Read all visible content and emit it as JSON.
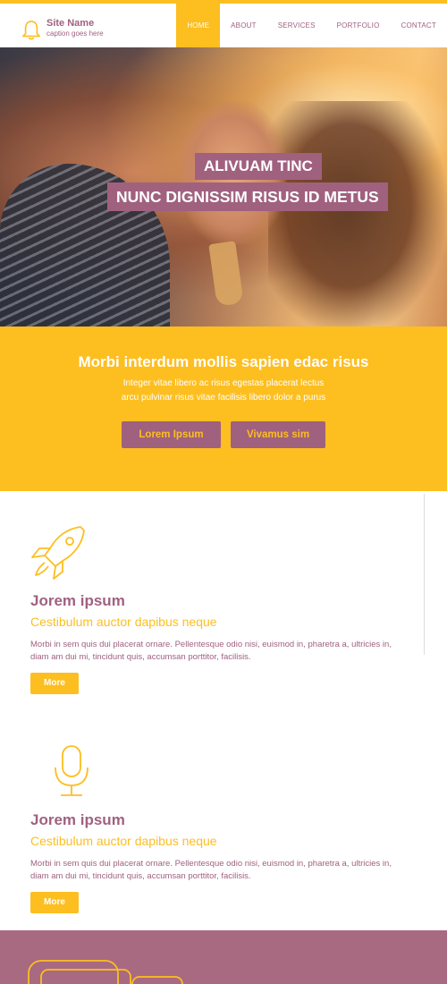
{
  "header": {
    "site_name": "Site Name",
    "caption": "caption goes here",
    "nav": [
      {
        "label": "HOME",
        "active": true
      },
      {
        "label": "ABOUT",
        "active": false
      },
      {
        "label": "SERVICES",
        "active": false
      },
      {
        "label": "PORTFOLIO",
        "active": false
      },
      {
        "label": "CONTACT",
        "active": false
      }
    ]
  },
  "hero": {
    "line1": "ALIVUAM TINC",
    "line2": "NUNC DIGNISSIM RISUS ID METUS"
  },
  "cta": {
    "title": "Morbi interdum mollis sapien edac risus",
    "text": "Integer vitae libero ac risus egestas placerat lectus arcu pulvinar risus vitae facilisis libero dolor a purus",
    "button1": "Lorem Ipsum",
    "button2": "Vivamus sim"
  },
  "features": [
    {
      "icon": "rocket-icon",
      "title": "Jorem ipsum",
      "subtitle": "Cestibulum auctor dapibus neque",
      "text": "Morbi in sem quis dui placerat ornare. Pellentesque odio nisi, euismod in, pharetra a, ultricies in, diam am dui mi, tincidunt quis, accumsan porttitor, facilisis.",
      "button": "More"
    },
    {
      "icon": "microphone-icon",
      "title": "Jorem ipsum",
      "subtitle": "Cestibulum auctor dapibus neque",
      "text": "Morbi in sem quis dui placerat ornare. Pellentesque odio nisi, euismod in, pharetra a, ultricies in, diam am dui mi, tincidunt quis, accumsan porttitor, facilisis.",
      "button": "More"
    }
  ],
  "colors": {
    "accent": "#FDBE20",
    "brand": "#A0617F",
    "footer": "#A86A80"
  }
}
